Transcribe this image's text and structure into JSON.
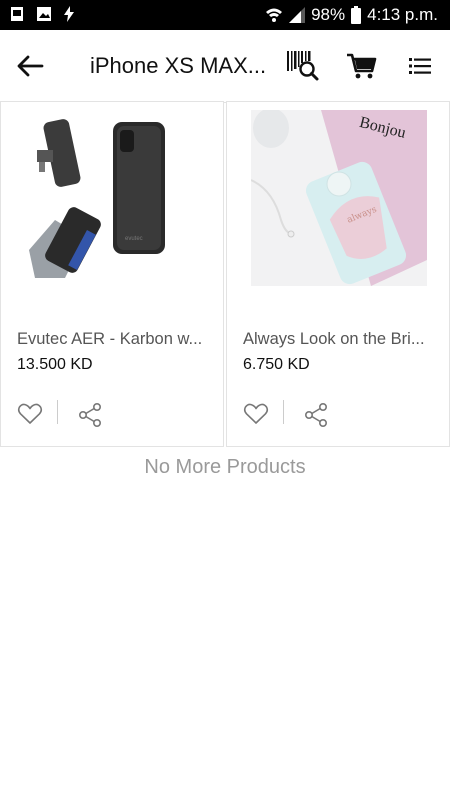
{
  "status": {
    "battery": "98%",
    "time": "4:13 p.m."
  },
  "header": {
    "title": "iPhone XS MAX..."
  },
  "icons": {
    "back": "arrow-left-icon",
    "barcode": "barcode-search-icon",
    "cart": "cart-icon",
    "list": "list-view-icon",
    "fav": "heart-icon",
    "share": "share-icon"
  },
  "products": [
    {
      "name": "Evutec AER - Karbon w...",
      "price": "13.500 KD"
    },
    {
      "name": "Always Look on the Bri...",
      "price": "6.750 KD"
    }
  ],
  "footer": {
    "no_more": "No More Products"
  },
  "colors": {
    "statusbar": "#000000",
    "text_muted": "#9a9a9a",
    "border": "#e3e3e3"
  }
}
